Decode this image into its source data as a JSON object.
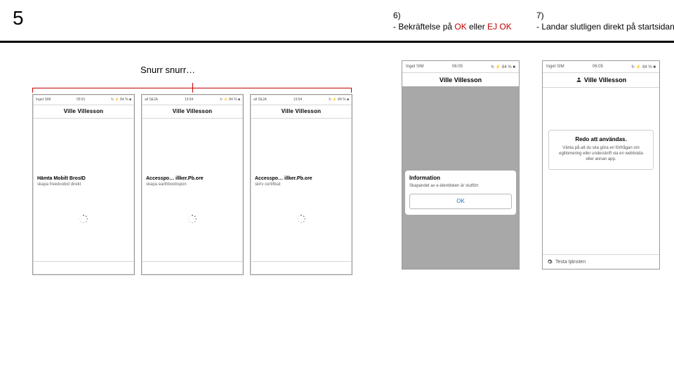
{
  "slide_number": "5",
  "step6": {
    "num": "6)",
    "text_before": "- Bekräftelse på ",
    "ok": "OK",
    "mid": " eller ",
    "ej_ok": "EJ OK"
  },
  "step7": {
    "num": "7)",
    "text": "- Landar slutligen direkt på startsidan"
  },
  "snurr_label": "Snurr snurr…",
  "status_bar": {
    "carrier_small": "Inget SIM",
    "carrier_short": "all SEJA",
    "time1": "05:51",
    "time2": "13:54",
    "time_big": "06:05",
    "battery": "↻ ⚡ 84 % ■"
  },
  "phone_title": "Ville Villesson",
  "loading_phones": [
    {
      "line1": "Hämta Mobilt BrosID",
      "line2": "skapa freedoobid direkt"
    },
    {
      "line1": "Accesspo… illker.Pb.ore",
      "line2": "skapa earthboobspon"
    },
    {
      "line1": "Accesspo… illker.Pb.ore",
      "line2": "skriv certifikat"
    }
  ],
  "modal": {
    "title": "Information",
    "body": "Skapandet av e-identiteten är slutfört",
    "ok": "OK"
  },
  "start_card": {
    "title": "Redo att användas.",
    "body": "Vänta på att du ska göra en förfrågan om egillomering eller underskrift via en webbsida eller annan app."
  },
  "footer7": "Testa tjänsten"
}
